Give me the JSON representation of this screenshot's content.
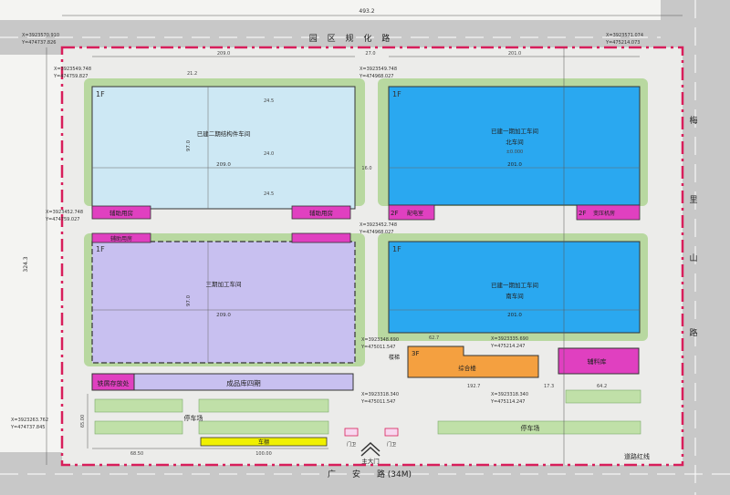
{
  "roads": {
    "north": "园 区 规 化 路",
    "east": [
      "梅",
      "里",
      "山",
      "路"
    ],
    "south": "广　　安　　路 (34M)",
    "red_line": "道路红线"
  },
  "overall_width": "493.2",
  "overall_depth": "324.3",
  "buildings": {
    "phase2_steel": {
      "floor": "1F",
      "name": "已建二期结构件车间",
      "length": "209.0",
      "width": "97.0"
    },
    "phase1_north": {
      "floor": "1F",
      "name": [
        "已建一期加工车间",
        "北车间"
      ],
      "length": "201.0"
    },
    "phase3": {
      "floor": "1F",
      "name": "三期加工车间",
      "length": "209.0",
      "width": "97.0"
    },
    "phase1_south": {
      "floor": "1F",
      "name": [
        "已建一期加工车间",
        "南车间"
      ],
      "length": "201.0"
    },
    "aux_rooms": [
      "辅助用房",
      "辅助用房",
      "辅助用房"
    ],
    "power_room": {
      "floor": "2F",
      "name": "配电室"
    },
    "substation": {
      "floor": "2F",
      "name": "变压机房"
    },
    "office": {
      "floor": "3F",
      "name": "综合楼"
    },
    "material_store": {
      "name": "辅料库"
    },
    "scrap": "铁屑存放处",
    "warehouse": "成品库四期",
    "parking": [
      "停车场",
      "停车场"
    ],
    "sheds": [
      "车棚"
    ],
    "main_gate": "主大门",
    "gates": [
      "门卫",
      "门卫"
    ],
    "stair": "楼梯"
  },
  "coords": [
    {
      "x": "X=3923570.910",
      "y": "Y=474737.826"
    },
    {
      "x": "X=3923571.074",
      "y": "Y=475214.073"
    },
    {
      "x": "X=3923549.748",
      "y": "Y=474759.827"
    },
    {
      "x": "X=3923549.748",
      "y": "Y=474968.027"
    },
    {
      "x": "X=3923452.748",
      "y": "Y=474759.027"
    },
    {
      "x": "X=3923452.748",
      "y": "Y=474968.027"
    },
    {
      "x": "X=3923348.690",
      "y": "Y=475011.547"
    },
    {
      "x": "X=3923318.340",
      "y": "Y=475011.547"
    },
    {
      "x": "X=3923335.690",
      "y": "Y=475214.247"
    },
    {
      "x": "X=3923318.340",
      "y": "Y=475114.247"
    },
    {
      "x": "X=3923263.762",
      "y": "Y=474737.845"
    }
  ],
  "dims": [
    "209.0",
    "27.0",
    "201.0",
    "16.0",
    "24.5",
    "24.0",
    "24.5",
    "21.2",
    "62.7",
    "192.7",
    "17.3",
    "64.2",
    "68.50",
    "100.00",
    "65.00",
    "±0.000"
  ],
  "colors": {
    "bg": "#f4f4f2",
    "road": "#c8c8c8",
    "green": "#b8d8a0",
    "redline": "#d81e5b",
    "bldg_blue_light": "#cde8f4",
    "bldg_blue": "#2aa8f0",
    "bldg_purple": "#c8c0f0",
    "magenta": "#e040c0",
    "orange": "#f4a040",
    "yellow": "#f0f000"
  }
}
